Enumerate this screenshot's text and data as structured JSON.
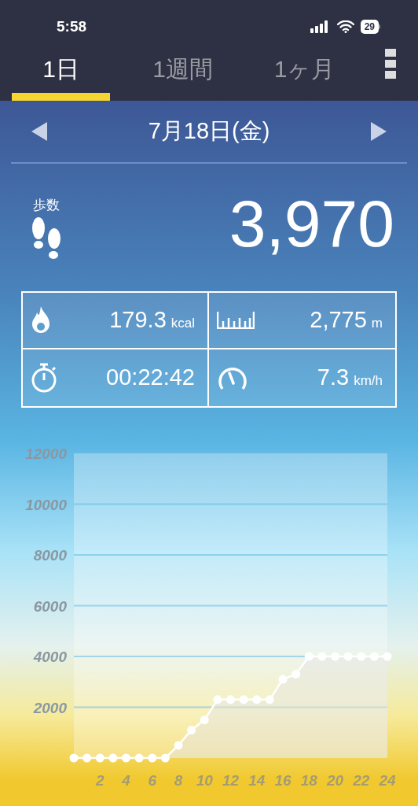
{
  "status_bar": {
    "time": "5:58",
    "battery": "29"
  },
  "tabs": [
    {
      "label": "1日",
      "selected": true
    },
    {
      "label": "1週間",
      "selected": false
    },
    {
      "label": "1ヶ月",
      "selected": false
    }
  ],
  "date": "7月18日(金)",
  "steps": {
    "label": "歩数",
    "value": "3,970"
  },
  "stats": [
    {
      "kind": "calories",
      "value": "179.3",
      "unit": "kcal"
    },
    {
      "kind": "distance",
      "value": "2,775",
      "unit": "m"
    },
    {
      "kind": "time",
      "value": "00:22:42"
    },
    {
      "kind": "speed",
      "value": "7.3",
      "unit": "km/h"
    }
  ],
  "chart_data": {
    "type": "line",
    "x": [
      0,
      1,
      2,
      3,
      4,
      5,
      6,
      7,
      8,
      9,
      10,
      11,
      12,
      13,
      14,
      15,
      16,
      17,
      18,
      19,
      20,
      21,
      22,
      23,
      24
    ],
    "series": [
      {
        "color": "#ffffff",
        "marker": "circle",
        "values": [
          0,
          0,
          0,
          0,
          0,
          0,
          0,
          0,
          500,
          1100,
          1500,
          2300,
          2300,
          2300,
          2300,
          2300,
          3100,
          3300,
          4000,
          4000,
          4000,
          4000,
          4000,
          4000,
          4000
        ]
      }
    ],
    "grid": true,
    "xlim": [
      0,
      24
    ],
    "ylim": [
      0,
      12000
    ],
    "xticks": [
      2,
      4,
      6,
      8,
      10,
      12,
      14,
      16,
      18,
      20,
      22,
      24
    ],
    "yticks": [
      2000,
      4000,
      6000,
      8000,
      10000,
      12000
    ]
  }
}
